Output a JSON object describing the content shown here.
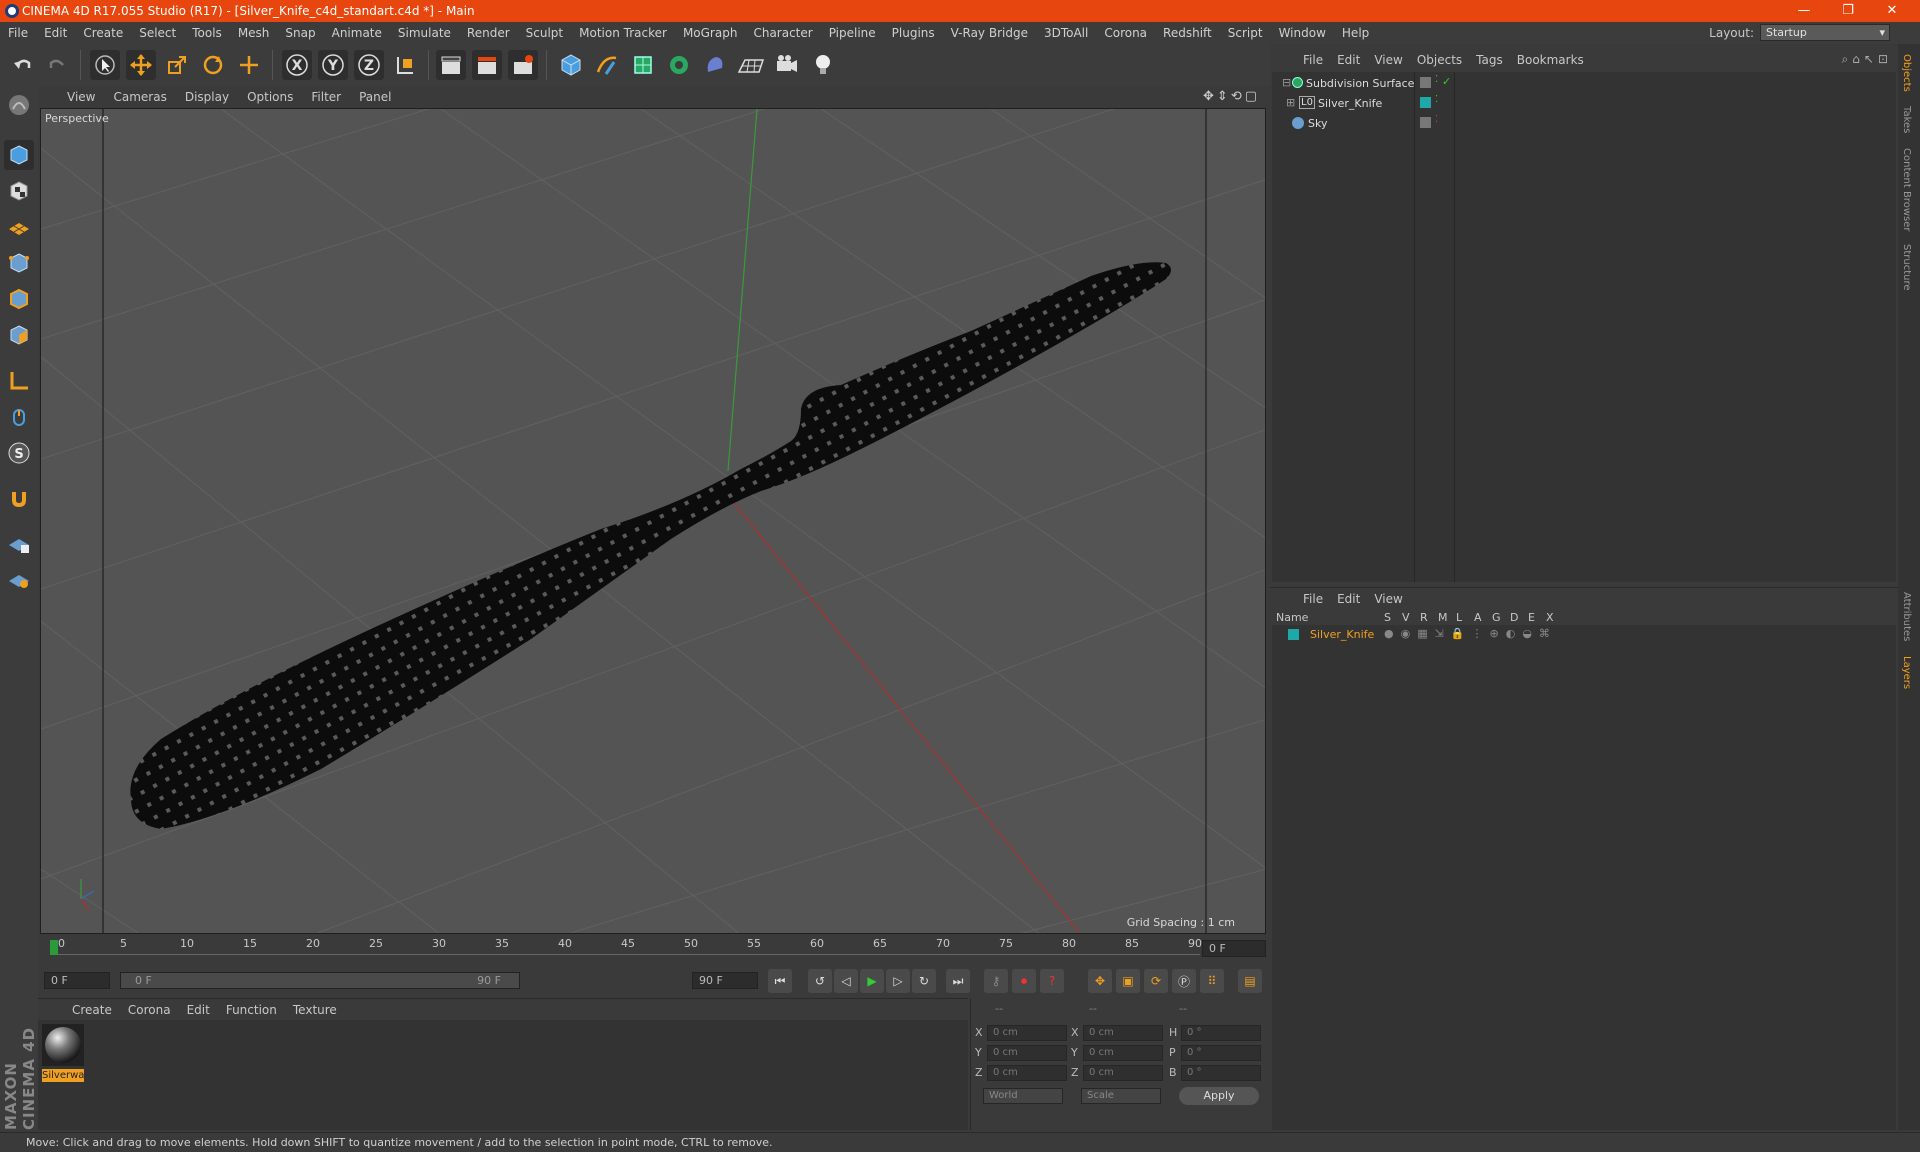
{
  "window": {
    "title": "CINEMA 4D R17.055 Studio (R17) - [Silver_Knife_c4d_standart.c4d *] - Main",
    "min": "—",
    "max": "❐",
    "close": "✕"
  },
  "menubar": {
    "items": [
      "File",
      "Edit",
      "Create",
      "Select",
      "Tools",
      "Mesh",
      "Snap",
      "Animate",
      "Simulate",
      "Render",
      "Sculpt",
      "Motion Tracker",
      "MoGraph",
      "Character",
      "Pipeline",
      "Plugins",
      "V-Ray Bridge",
      "3DToAll",
      "Corona",
      "Redshift",
      "Script",
      "Window",
      "Help"
    ],
    "layout_label": "Layout:",
    "layout_value": "Startup"
  },
  "viewport": {
    "menu": [
      "View",
      "Cameras",
      "Display",
      "Options",
      "Filter",
      "Panel"
    ],
    "label": "Perspective",
    "grid_spacing": "Grid Spacing : 1 cm"
  },
  "timeline": {
    "ticks": [
      "0",
      "5",
      "10",
      "15",
      "20",
      "25",
      "30",
      "35",
      "40",
      "45",
      "50",
      "55",
      "60",
      "65",
      "70",
      "75",
      "80",
      "85",
      "90"
    ],
    "current_frame": "0 F",
    "start_field": "0 F",
    "slider_start": "0 F",
    "slider_end": "90 F",
    "end_field": "90 F"
  },
  "materials": {
    "menu": [
      "Create",
      "Corona",
      "Edit",
      "Function",
      "Texture"
    ],
    "items": [
      {
        "name": "Silverwa"
      }
    ]
  },
  "coords": {
    "headers": [
      "--",
      "--",
      "--"
    ],
    "rows": [
      {
        "a": "X",
        "av": "0 cm",
        "b": "X",
        "bv": "0 cm",
        "c": "H",
        "cv": "0 °"
      },
      {
        "a": "Y",
        "av": "0 cm",
        "b": "Y",
        "bv": "0 cm",
        "c": "P",
        "cv": "0 °"
      },
      {
        "a": "Z",
        "av": "0 cm",
        "b": "Z",
        "bv": "0 cm",
        "c": "B",
        "cv": "0 °"
      }
    ],
    "mode1": "World",
    "mode2": "Scale",
    "apply": "Apply"
  },
  "objects": {
    "menu": [
      "File",
      "Edit",
      "View",
      "Objects",
      "Tags",
      "Bookmarks"
    ],
    "items": [
      {
        "name": "Subdivision Surface"
      },
      {
        "name": "Silver_Knife"
      },
      {
        "name": "Sky"
      }
    ]
  },
  "layers": {
    "menu": [
      "File",
      "Edit",
      "View"
    ],
    "columns": [
      "Name",
      "S",
      "V",
      "R",
      "M",
      "L",
      "A",
      "G",
      "D",
      "E",
      "X"
    ],
    "items": [
      {
        "name": "Silver_Knife"
      }
    ]
  },
  "side_tabs": [
    "Objects",
    "Takes",
    "Content Browser",
    "Structure",
    "Attributes",
    "Layers"
  ],
  "brand": "MAXON CINEMA 4D",
  "status": "Move: Click and drag to move elements. Hold down SHIFT to quantize movement / add to the selection in point mode, CTRL to remove.",
  "colors": {
    "accent": "#e8460f",
    "selected": "#f0a020",
    "teal": "#1fa8a8"
  }
}
